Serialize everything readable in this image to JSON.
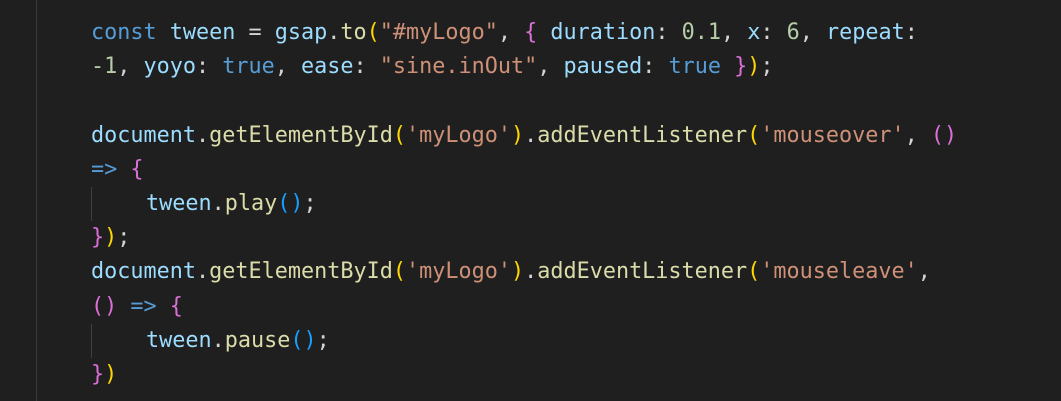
{
  "editor": {
    "theme_colors": {
      "background": "#1f1f1f",
      "keyword": "#569cd6",
      "variable": "#9cdcfe",
      "function": "#dcdcaa",
      "string": "#ce9178",
      "number": "#b5cea8",
      "bracket_level_1": "#ffd700",
      "bracket_level_2": "#da70d6",
      "bracket_level_3": "#179fff"
    },
    "lines": [
      [
        {
          "t": "const",
          "c": "storage"
        },
        {
          "t": " ",
          "c": "op"
        },
        {
          "t": "tween",
          "c": "var"
        },
        {
          "t": " = ",
          "c": "op"
        },
        {
          "t": "gsap",
          "c": "var"
        },
        {
          "t": ".",
          "c": "punc"
        },
        {
          "t": "to",
          "c": "fn"
        },
        {
          "t": "(",
          "c": "b1"
        },
        {
          "t": "\"#myLogo\"",
          "c": "str"
        },
        {
          "t": ", ",
          "c": "punc"
        },
        {
          "t": "{",
          "c": "b2"
        },
        {
          "t": " ",
          "c": "op"
        },
        {
          "t": "duration",
          "c": "var"
        },
        {
          "t": ": ",
          "c": "punc"
        },
        {
          "t": "0.1",
          "c": "num"
        },
        {
          "t": ", ",
          "c": "punc"
        },
        {
          "t": "x",
          "c": "var"
        },
        {
          "t": ": ",
          "c": "punc"
        },
        {
          "t": "6",
          "c": "num"
        },
        {
          "t": ", ",
          "c": "punc"
        },
        {
          "t": "repeat",
          "c": "var"
        },
        {
          "t": ":",
          "c": "punc"
        }
      ],
      [
        {
          "t": "-1",
          "c": "num"
        },
        {
          "t": ", ",
          "c": "punc"
        },
        {
          "t": "yoyo",
          "c": "var"
        },
        {
          "t": ": ",
          "c": "punc"
        },
        {
          "t": "true",
          "c": "bool"
        },
        {
          "t": ", ",
          "c": "punc"
        },
        {
          "t": "ease",
          "c": "var"
        },
        {
          "t": ": ",
          "c": "punc"
        },
        {
          "t": "\"sine.inOut\"",
          "c": "str"
        },
        {
          "t": ", ",
          "c": "punc"
        },
        {
          "t": "paused",
          "c": "var"
        },
        {
          "t": ": ",
          "c": "punc"
        },
        {
          "t": "true",
          "c": "bool"
        },
        {
          "t": " ",
          "c": "op"
        },
        {
          "t": "}",
          "c": "b2"
        },
        {
          "t": ")",
          "c": "b1"
        },
        {
          "t": ";",
          "c": "punc"
        }
      ],
      [],
      [
        {
          "t": "document",
          "c": "var"
        },
        {
          "t": ".",
          "c": "punc"
        },
        {
          "t": "getElementById",
          "c": "fn"
        },
        {
          "t": "(",
          "c": "b1"
        },
        {
          "t": "'myLogo'",
          "c": "str"
        },
        {
          "t": ")",
          "c": "b1"
        },
        {
          "t": ".",
          "c": "punc"
        },
        {
          "t": "addEventListener",
          "c": "fn"
        },
        {
          "t": "(",
          "c": "b1"
        },
        {
          "t": "'mouseover'",
          "c": "str"
        },
        {
          "t": ", ",
          "c": "punc"
        },
        {
          "t": "()",
          "c": "b2"
        }
      ],
      [
        {
          "t": "=>",
          "c": "storage"
        },
        {
          "t": " ",
          "c": "op"
        },
        {
          "t": "{",
          "c": "b2"
        }
      ],
      {
        "indent": 1,
        "tokens": [
          {
            "t": "tween",
            "c": "var"
          },
          {
            "t": ".",
            "c": "punc"
          },
          {
            "t": "play",
            "c": "fn"
          },
          {
            "t": "()",
            "c": "b3"
          },
          {
            "t": ";",
            "c": "punc"
          }
        ]
      },
      [
        {
          "t": "}",
          "c": "b2"
        },
        {
          "t": ")",
          "c": "b1"
        },
        {
          "t": ";",
          "c": "punc"
        }
      ],
      [
        {
          "t": "document",
          "c": "var"
        },
        {
          "t": ".",
          "c": "punc"
        },
        {
          "t": "getElementById",
          "c": "fn"
        },
        {
          "t": "(",
          "c": "b1"
        },
        {
          "t": "'myLogo'",
          "c": "str"
        },
        {
          "t": ")",
          "c": "b1"
        },
        {
          "t": ".",
          "c": "punc"
        },
        {
          "t": "addEventListener",
          "c": "fn"
        },
        {
          "t": "(",
          "c": "b1"
        },
        {
          "t": "'mouseleave'",
          "c": "str"
        },
        {
          "t": ",",
          "c": "punc"
        }
      ],
      [
        {
          "t": "()",
          "c": "b2"
        },
        {
          "t": " ",
          "c": "op"
        },
        {
          "t": "=>",
          "c": "storage"
        },
        {
          "t": " ",
          "c": "op"
        },
        {
          "t": "{",
          "c": "b2"
        }
      ],
      {
        "indent": 1,
        "tokens": [
          {
            "t": "tween",
            "c": "var"
          },
          {
            "t": ".",
            "c": "punc"
          },
          {
            "t": "pause",
            "c": "fn"
          },
          {
            "t": "()",
            "c": "b3"
          },
          {
            "t": ";",
            "c": "punc"
          }
        ]
      },
      [
        {
          "t": "}",
          "c": "b2"
        },
        {
          "t": ")",
          "c": "b1"
        }
      ]
    ]
  }
}
